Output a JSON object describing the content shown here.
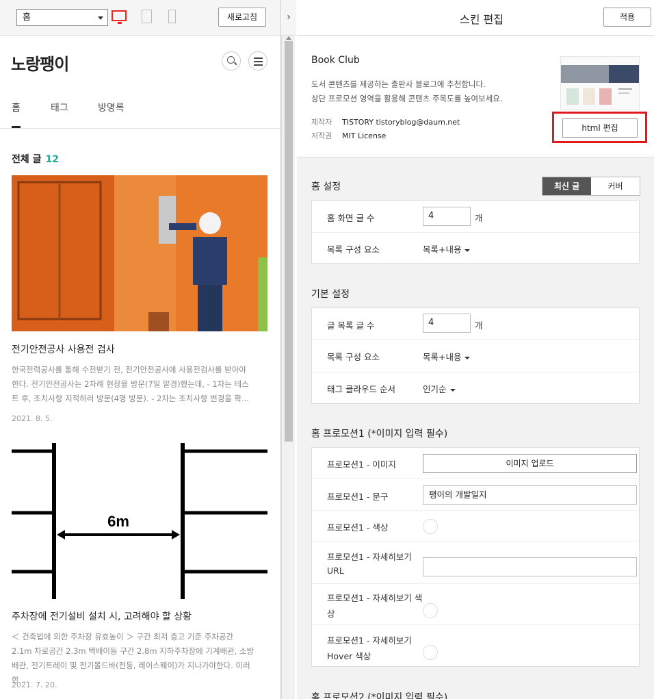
{
  "preview": {
    "page_select": "홈",
    "refresh_label": "새로고침",
    "collapse_label": "›",
    "blog_title": "노랑팽이",
    "nav": [
      "홈",
      "태그",
      "방명록"
    ],
    "total_label": "전체 글",
    "total_count": "12",
    "posts": [
      {
        "title": "전기안전공사 사용전 검사",
        "excerpt": "한국전력공사를 통해 수전받기 전, 전기안전공사에 사용전검사를 받아야 한다. 전기안전공사는 2차례 현장을 방문(7일 말경)했는데, - 1차는 테스트 후, 조치사항 지적하러 방문(4명 방문). - 2차는 조치사항 변경을 확...",
        "date": "2021. 8. 5."
      },
      {
        "title": "주차장에 전기설비 설치 시, 고려해야 할 상황",
        "image_label": "6m",
        "excerpt": "＜ 건축법에 의한 주차장 유효높이 ＞ 구간 최저 층고 기준 주차공간 2.1m 차로공간 2.3m 택배이동 구간 2.8m  지하주차장에 기계배관, 소방배관, 전기트레이 및 전기몰드바(전등, 레이스웨이)가 지나가야한다. 이러한 ...",
        "date": "2021. 7. 20."
      }
    ]
  },
  "editor": {
    "title": "스킨 편집",
    "apply_label": "적용",
    "skin_name": "Book Club",
    "desc_line1": "도서 콘텐츠를 제공하는 출판사 블로그에 추천합니다.",
    "desc_line2": "상단 프로모션 영역을 활용해 콘텐츠 주목도를 높여보세요.",
    "maker_key": "제작자",
    "maker_val": "TISTORY tistoryblog@daum.net",
    "license_key": "저작권",
    "license_val": "MIT License",
    "html_edit_label": "html 편집",
    "home": {
      "heading": "홈 설정",
      "toggle_on": "최신 글",
      "toggle_off": "커버",
      "count_label": "홈 화면 글 수",
      "count_value": "4",
      "unit": "개",
      "list_label": "목록 구성 요소",
      "list_value": "목록+내용"
    },
    "basic": {
      "heading": "기본 설정",
      "count_label": "글 목록 글 수",
      "count_value": "4",
      "unit": "개",
      "list_label": "목록 구성 요소",
      "list_value": "목록+내용",
      "tag_label": "태그 클라우드 순서",
      "tag_value": "인기순"
    },
    "promo1": {
      "heading": "홈 프로모션1 (*이미지 입력 필수)",
      "image_label": "프로모션1 - 이미지",
      "upload_label": "이미지 업로드",
      "text_label": "프로모션1 - 문구",
      "text_value": "팽이의 개발일지",
      "color_label": "프로모션1 - 색상",
      "url_label_1": "프로모션1 - 자세히보기",
      "url_label_2": "URL",
      "more_color_label_1": "프로모션1 - 자세히보기 색",
      "more_color_label_2": "상",
      "hover_label_1": "프로모션1 - 자세히보기",
      "hover_label_2": "Hover 색상"
    },
    "promo2_heading": "홈 프로모션2 (*이미지 입력 필수)"
  },
  "colors": {
    "accent_red": "#e4171e",
    "count_teal": "#1aa890"
  }
}
